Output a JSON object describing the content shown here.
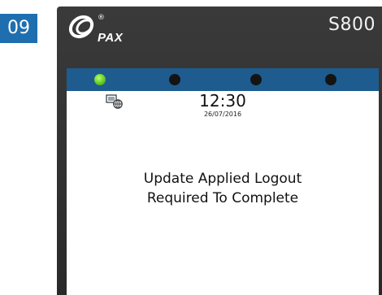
{
  "step": {
    "number": "09",
    "color": "#1f6fb0"
  },
  "device": {
    "brand": "PAX",
    "registered_mark": "®",
    "model": "S800"
  },
  "status_leds": [
    {
      "state": "on",
      "color": "#6cd12a"
    },
    {
      "state": "off",
      "color": "#141414"
    },
    {
      "state": "off",
      "color": "#141414"
    },
    {
      "state": "off",
      "color": "#141414"
    }
  ],
  "screen": {
    "status_icon": "network-globe-icon",
    "time": "12:30",
    "date": "26/07/2016",
    "message_line1": "Update Applied Logout",
    "message_line2": "Required To Complete"
  }
}
